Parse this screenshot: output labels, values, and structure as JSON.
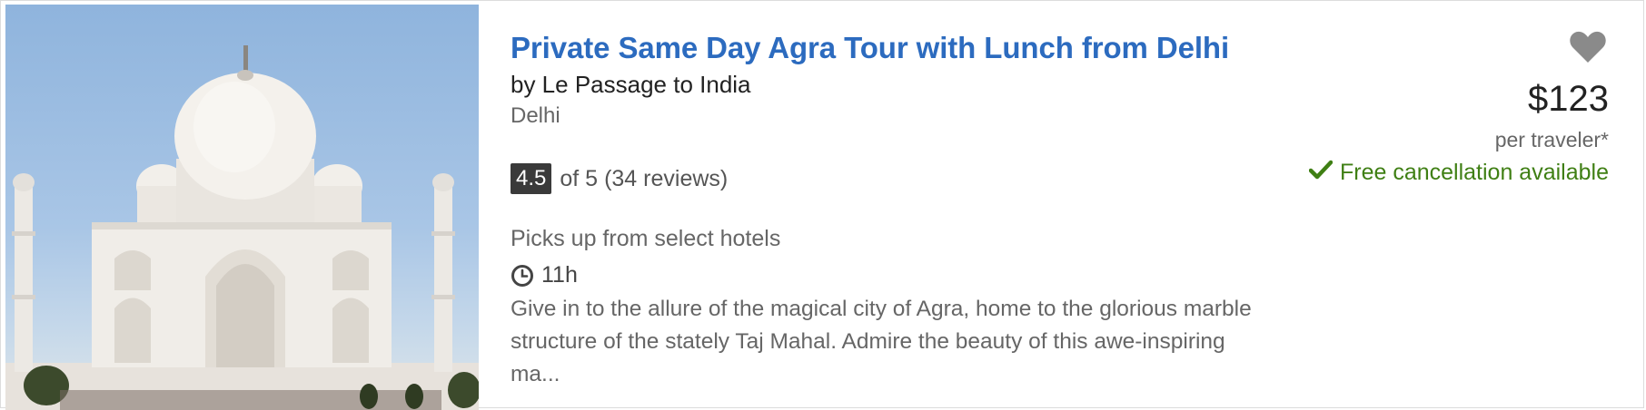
{
  "listing": {
    "title": "Private Same Day Agra Tour with Lunch from Delhi",
    "operator": "by Le Passage to India",
    "location": "Delhi",
    "rating": {
      "score": "4.5",
      "out_of": "of 5",
      "reviews": "(34 reviews)"
    },
    "pickup": "Picks up from select hotels",
    "duration": "11h",
    "description": "Give in to the allure of the magical city of Agra, home to the glorious marble structure of the stately Taj Mahal. Admire the beauty of this awe-inspiring ma...",
    "price": "$123",
    "price_unit": "per traveler*",
    "cancellation": "Free cancellation available",
    "icons": {
      "favorite": "heart-icon",
      "duration": "clock-icon",
      "cancellation": "check-icon"
    },
    "colors": {
      "title": "#2c6bbf",
      "cancellation": "#3f7f14",
      "badge": "#3a3a3a",
      "heart": "#8a8a8a"
    }
  }
}
